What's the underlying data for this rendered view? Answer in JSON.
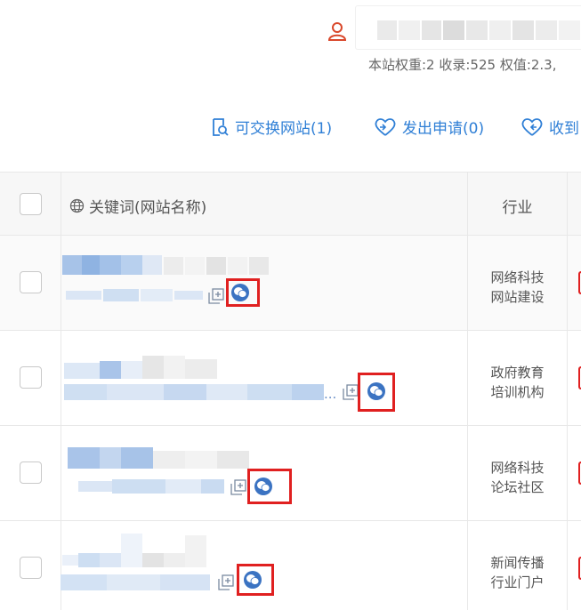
{
  "header": {
    "user_icon": "user-icon",
    "stats_text": "本站权重:2 收录:525 权值:2.3,"
  },
  "actions": [
    {
      "label": "可交换网站(1)",
      "icon": "search-doc-icon"
    },
    {
      "label": "发出申请(0)",
      "icon": "heart-arrow-icon"
    },
    {
      "label": "收到",
      "icon": "heart-arrow-icon"
    }
  ],
  "table": {
    "columns": {
      "keyword": "关键词(网站名称)",
      "industry": "行业"
    },
    "rows": [
      {
        "industry": [
          "网络科技",
          "网站建设"
        ]
      },
      {
        "industry": [
          "政府教育",
          "培训机构"
        ],
        "ellipsis": "..."
      },
      {
        "industry": [
          "网络科技",
          "论坛社区"
        ]
      },
      {
        "industry": [
          "新闻传播",
          "行业门户"
        ]
      }
    ]
  },
  "colors": {
    "accent": "#2f7fd6",
    "highlight": "#e02020",
    "wechat": "#3b73c2",
    "user_icon": "#d9482b"
  }
}
